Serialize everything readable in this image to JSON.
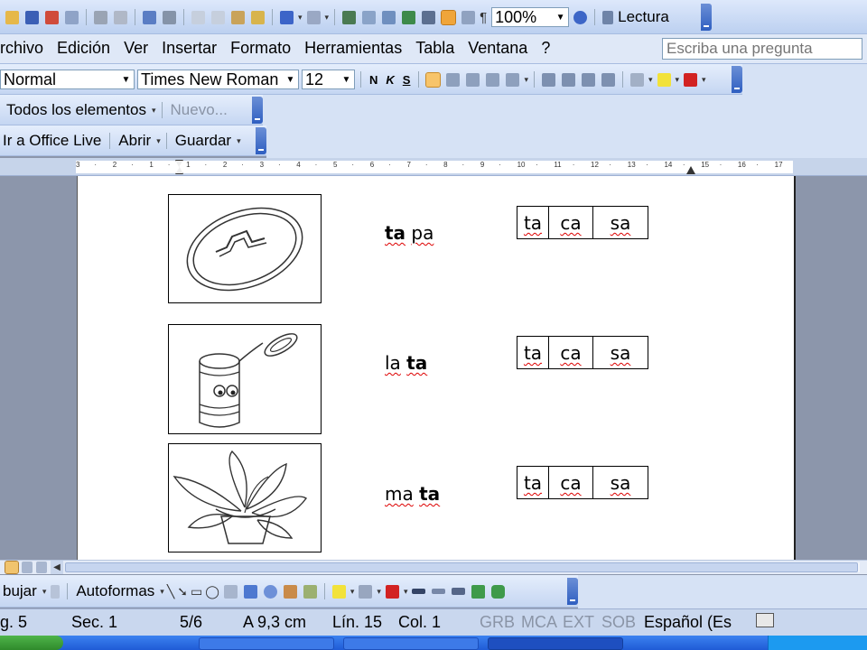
{
  "toolbar": {
    "zoom": "100%",
    "lectura": "Lectura"
  },
  "menu": {
    "archivo": "rchivo",
    "edicion": "Edición",
    "ver": "Ver",
    "insertar": "Insertar",
    "formato": "Formato",
    "herramientas": "Herramientas",
    "tabla": "Tabla",
    "ventana": "Ventana",
    "ayuda": "?",
    "ask_placeholder": "Escriba una pregunta"
  },
  "format": {
    "style": "Normal",
    "font": "Times New Roman",
    "size": "12",
    "bold": "N",
    "italic": "K",
    "underline": "S"
  },
  "clipboard_bar": {
    "all_elements": "Todos los elementos",
    "new": "Nuevo..."
  },
  "web_bar": {
    "office_live": "Ir a Office Live",
    "open": "Abrir",
    "save": "Guardar"
  },
  "ruler": {
    "ticks": [
      "3",
      "·",
      "2",
      "·",
      "1",
      "·",
      "1",
      "·",
      "2",
      "·",
      "3",
      "·",
      "4",
      "·",
      "5",
      "·",
      "6",
      "·",
      "7",
      "·",
      "8",
      "·",
      "9",
      "·",
      "10",
      "·",
      "11",
      "·",
      "12",
      "·",
      "13",
      "·",
      "14",
      "·",
      "15",
      "·",
      "16",
      "·",
      "17"
    ]
  },
  "doc": {
    "rows": [
      {
        "word_a": "ta",
        "word_b": "pa",
        "bold": "a",
        "options": [
          "ta",
          "ca",
          "sa"
        ],
        "image": "coin-icon"
      },
      {
        "word_a": "la",
        "word_b": "ta",
        "bold": "b",
        "options": [
          "ta",
          "ca",
          "sa"
        ],
        "image": "can-icon"
      },
      {
        "word_a": "ma",
        "word_b": "ta",
        "bold": "b",
        "options": [
          "ta",
          "ca",
          "sa"
        ],
        "image": "plant-icon"
      }
    ]
  },
  "draw_bar": {
    "draw": "bujar",
    "autoshapes": "Autoformas"
  },
  "status": {
    "page": "g. 5",
    "section": "Sec. 1",
    "pages": "5/6",
    "at": "A 9,3 cm",
    "line": "Lín. 15",
    "col": "Col. 1",
    "rec": "GRB",
    "trk": "MCA",
    "ext": "EXT",
    "ovr": "SOB",
    "lang": "Español (Es"
  }
}
